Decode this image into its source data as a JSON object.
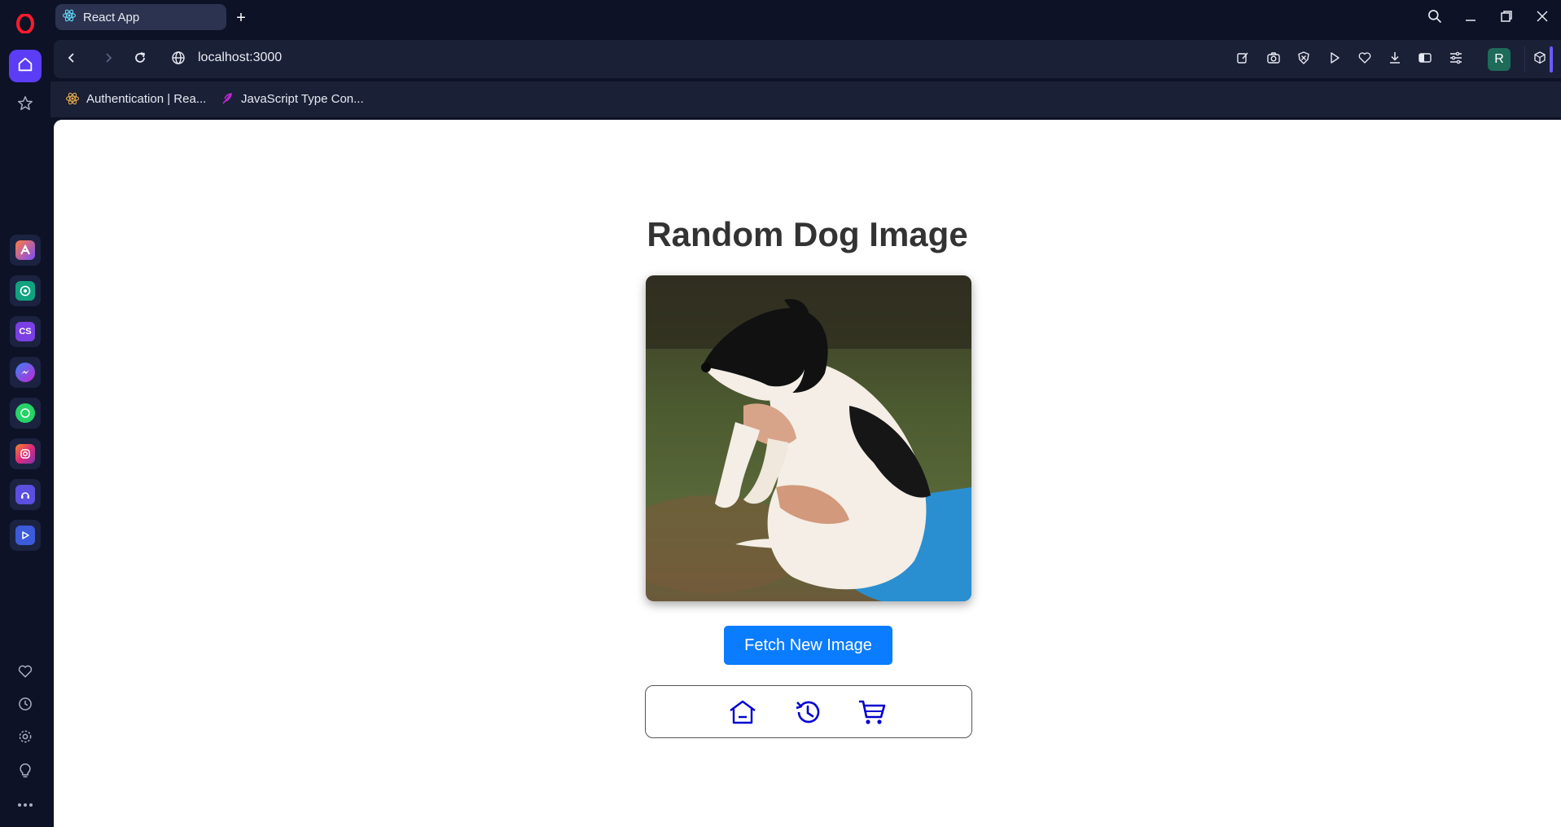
{
  "browser": {
    "tab": {
      "title": "React App"
    },
    "new_tab_symbol": "+",
    "address": {
      "url": "localhost:3000"
    },
    "profile_initial": "R",
    "bookmarks": [
      {
        "label": "Authentication | Rea...",
        "icon": "react-icon"
      },
      {
        "label": "JavaScript Type Con...",
        "icon": "feather-icon"
      }
    ],
    "sidebar_apps": [
      {
        "icon": "aria-icon",
        "color": "#e0552f"
      },
      {
        "icon": "chatgpt-icon",
        "color": "#10a37f"
      },
      {
        "icon": "cs-icon",
        "color": "#7b3fe4",
        "text": "CS"
      },
      {
        "icon": "messenger-icon",
        "color": "#8b5cf6"
      },
      {
        "icon": "whatsapp-icon",
        "color": "#25d366"
      },
      {
        "icon": "instagram-icon",
        "color": "#e1306c"
      },
      {
        "icon": "music-icon",
        "color": "#5b4fe0"
      },
      {
        "icon": "player-icon",
        "color": "#3b5bdb"
      }
    ]
  },
  "page": {
    "title": "Random Dog Image",
    "fetch_button_label": "Fetch New Image",
    "nav_icons": [
      "home-icon",
      "history-icon",
      "cart-icon"
    ],
    "accent_color": "#0a7cff",
    "nav_icon_color": "#0000d0"
  }
}
